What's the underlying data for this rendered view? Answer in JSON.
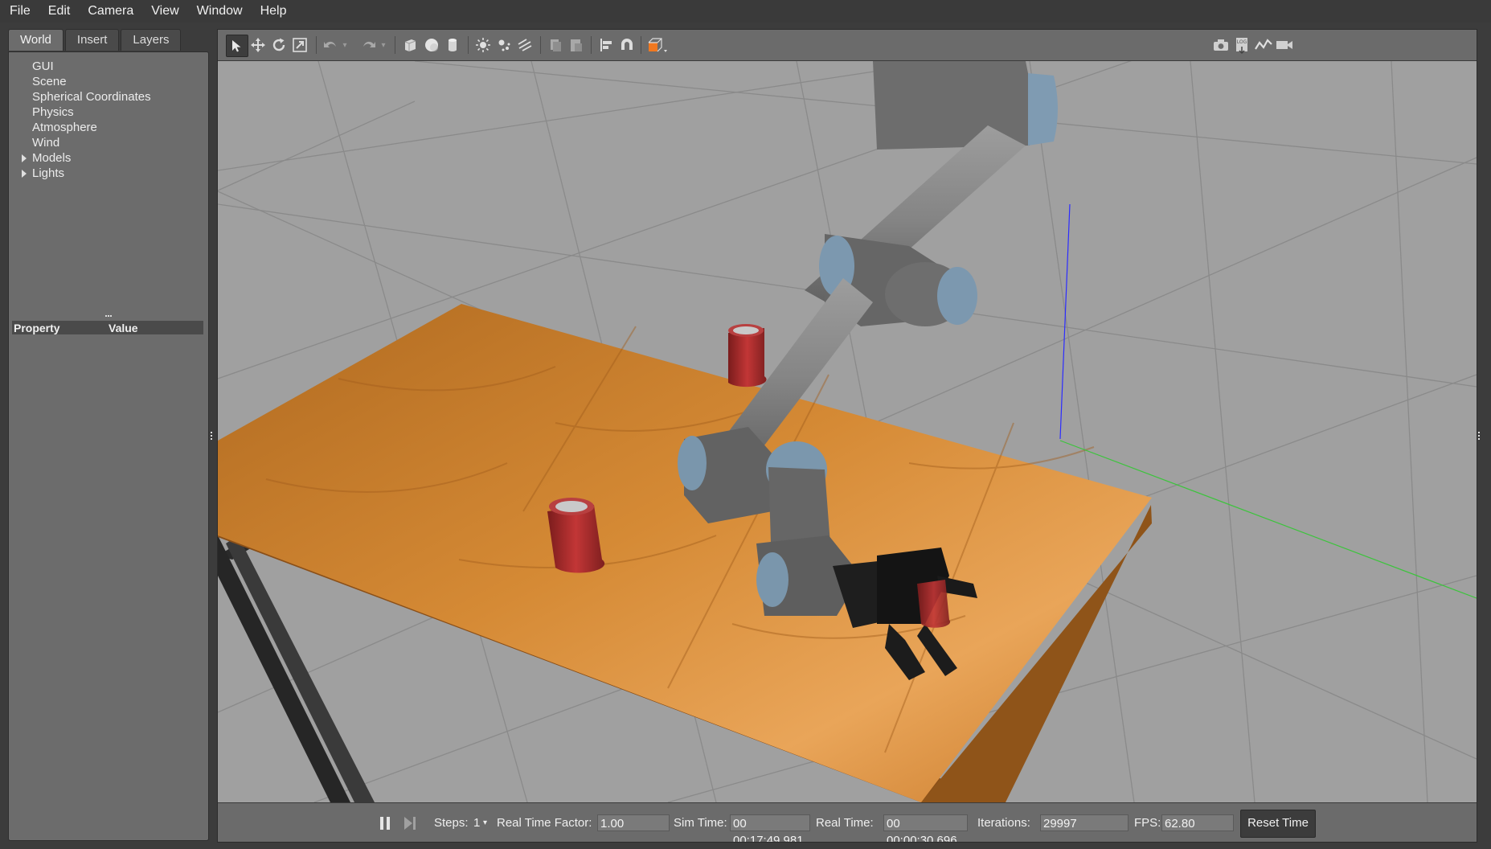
{
  "menu": [
    "File",
    "Edit",
    "Camera",
    "View",
    "Window",
    "Help"
  ],
  "left_panel": {
    "tabs": [
      "World",
      "Insert",
      "Layers"
    ],
    "tree": [
      {
        "label": "GUI",
        "expandable": false
      },
      {
        "label": "Scene",
        "expandable": false
      },
      {
        "label": "Spherical Coordinates",
        "expandable": false
      },
      {
        "label": "Physics",
        "expandable": false
      },
      {
        "label": "Atmosphere",
        "expandable": false
      },
      {
        "label": "Wind",
        "expandable": false
      },
      {
        "label": "Models",
        "expandable": true
      },
      {
        "label": "Lights",
        "expandable": true
      }
    ],
    "property_header": {
      "property": "Property",
      "value": "Value"
    }
  },
  "toolbar": {
    "tools": [
      "select-mode",
      "translate-mode",
      "rotate-mode",
      "scale-mode",
      "undo",
      "redo",
      "box-shape",
      "sphere-shape",
      "cylinder-shape",
      "point-light",
      "spot-light",
      "directional-light",
      "copy",
      "paste",
      "align",
      "snap",
      "view-angle"
    ],
    "right_tools": [
      "screenshot",
      "log",
      "plot",
      "record-video"
    ],
    "accent": "#f07820"
  },
  "status": {
    "steps_label": "Steps:",
    "steps_value": "1",
    "rtf_label": "Real Time Factor:",
    "rtf_value": "1.00",
    "sim_label": "Sim Time:",
    "sim_value": "00 00:17:49.981",
    "real_label": "Real Time:",
    "real_value": "00 00:00:30.696",
    "iter_label": "Iterations:",
    "iter_value": "29997",
    "fps_label": "FPS:",
    "fps_value": "62.80",
    "reset_label": "Reset Time"
  }
}
